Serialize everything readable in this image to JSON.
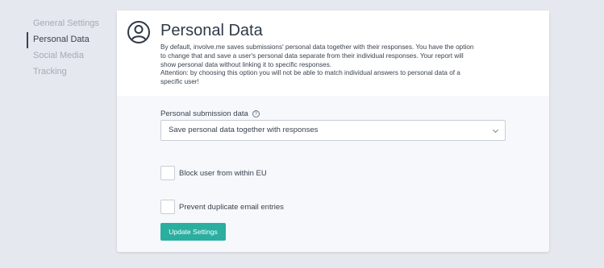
{
  "sidebar": {
    "items": [
      {
        "label": "General Settings"
      },
      {
        "label": "Personal Data"
      },
      {
        "label": "Social Media"
      },
      {
        "label": "Tracking"
      }
    ]
  },
  "header": {
    "title": "Personal Data",
    "description_lines": [
      "By default, involve.me saves submissions' personal data together with their responses. You have the option",
      "to change that and save a user's personal data separate from their individual responses. Your report will",
      "show personal data without linking it to specific responses.",
      "Attention: by choosing this option you will not be able to match individual answers to personal data of a",
      "specific user!"
    ]
  },
  "form": {
    "submission_label": "Personal submission data",
    "submission_value": "Save personal data together with responses",
    "block_eu_label": "Block user from within EU",
    "prevent_duplicates_label": "Prevent duplicate email entries",
    "update_button": "Update Settings"
  },
  "colors": {
    "accent": "#2aaea0",
    "background": "#e5e8ee"
  }
}
